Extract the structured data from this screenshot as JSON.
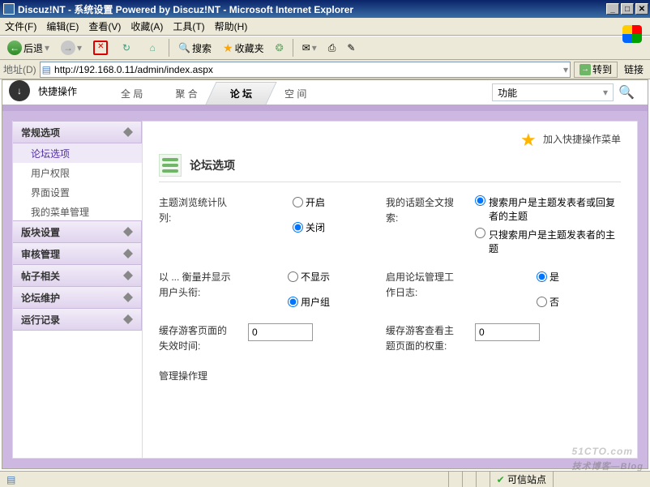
{
  "window": {
    "title": "Discuz!NT - 系统设置 Powered by Discuz!NT - Microsoft Internet Explorer"
  },
  "menu": {
    "file": "文件(F)",
    "edit": "编辑(E)",
    "view": "查看(V)",
    "fav": "收藏(A)",
    "tool": "工具(T)",
    "help": "帮助(H)"
  },
  "toolbar": {
    "back": "后退",
    "search": "搜索",
    "fav": "收藏夹"
  },
  "address": {
    "label": "地址(D)",
    "url": "http://192.168.0.11/admin/index.aspx",
    "go": "转到",
    "links": "链接"
  },
  "topnav": {
    "quick": "快捷操作",
    "tabs": {
      "gl": "全 局",
      "jh": "聚 合",
      "lt": "论 坛",
      "kj": "空 间"
    },
    "func": "功能"
  },
  "sidebar": {
    "g1": "常规选项",
    "items": [
      "论坛选项",
      "用户权限",
      "界面设置",
      "我的菜单管理"
    ],
    "g2": "版块设置",
    "g3": "审核管理",
    "g4": "帖子相关",
    "g5": "论坛维护",
    "g6": "运行记录"
  },
  "main": {
    "fav_add": "加入快捷操作菜单",
    "section": "论坛选项",
    "labels": {
      "topic_queue": "主题浏览统计队列:",
      "my_topic": "我的话题全文搜索:",
      "measure_title": "以 ... 衡量并显示用户头衔:",
      "enable_log": "启用论坛管理工作日志:",
      "cache_page": "缓存游客页面的失效时间:",
      "cache_weight": "缓存游客查看主题页面的权重:",
      "admin_reason": "管理操作理"
    },
    "options": {
      "on": "开启",
      "off": "关闭",
      "search_isreply": "搜索用户是主题发表者或回复者的主题",
      "search_isauthor": "只搜索用户是主题发表者的主题",
      "noshow": "不显示",
      "usergroup": "用户组",
      "yes": "是",
      "no": "否"
    },
    "values": {
      "cache_page": "0",
      "cache_weight": "0"
    }
  },
  "status": {
    "trusted": "可信站点"
  },
  "watermark": {
    "big": "51CTO.com",
    "small": "技术博客—Blog"
  }
}
